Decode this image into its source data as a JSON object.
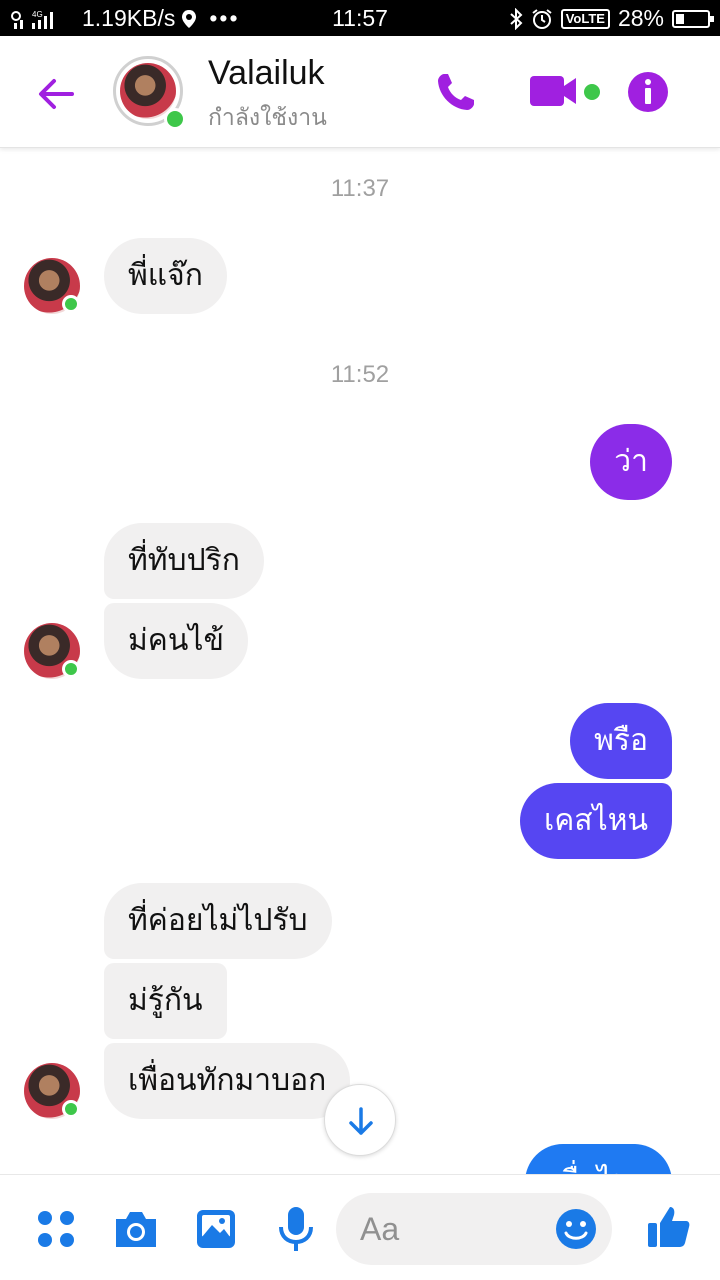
{
  "status_bar": {
    "network_speed": "1.19KB/s",
    "dots": "•••",
    "time": "11:57",
    "volte": "VoLTE",
    "battery": "28%",
    "battery_fraction": 0.28
  },
  "header": {
    "contact_name": "Valailuk",
    "contact_status": "กำลังใช้งาน",
    "icons": [
      "back-arrow-icon",
      "phone-icon",
      "video-camera-icon",
      "info-icon"
    ],
    "accent_color": "#a020e0"
  },
  "chat": {
    "timestamps": [
      "11:37",
      "11:52"
    ],
    "messages": [
      {
        "from": "contact",
        "text": "พี่แจ๊ก"
      },
      {
        "from": "me",
        "text": "ว่า"
      },
      {
        "from": "contact",
        "text": "ที่ทับปริก"
      },
      {
        "from": "contact",
        "text": "ม่คนไข้"
      },
      {
        "from": "me",
        "text": "พรือ"
      },
      {
        "from": "me",
        "text": "เคสไหน"
      },
      {
        "from": "contact",
        "text": "ที่ค่อยไม่ไปรับ"
      },
      {
        "from": "contact",
        "text": "ม่รู้กัน"
      },
      {
        "from": "contact",
        "text": "เพื่อนทักมาบอก"
      },
      {
        "from": "me",
        "text": "เมื่อไหร"
      }
    ],
    "bubble_colors": {
      "incoming": "#f1f0f0",
      "out_purple": "#8b2ce8",
      "out_indigo": "#5646f2",
      "out_blue": "#1f7af2"
    }
  },
  "composer": {
    "placeholder": "Aa",
    "icons": [
      "apps-grid-icon",
      "camera-icon",
      "image-icon",
      "microphone-icon",
      "emoji-icon",
      "thumbs-up-icon"
    ],
    "icon_color": "#1a7ae6"
  }
}
